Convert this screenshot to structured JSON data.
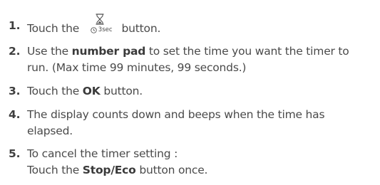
{
  "steps": [
    {
      "number": "1.",
      "before_icon": "Touch the",
      "icon": "hourglass-timer-icon",
      "icon_label": "3sec",
      "after_icon": "button."
    },
    {
      "number": "2.",
      "line1_pre": "Use the",
      "line1_bold": "number pad",
      "line1_post": "to set the time you want the timer to",
      "line2": "run. (Max time 99 minutes, 99 seconds.)"
    },
    {
      "number": "3.",
      "pre": "Touch the",
      "bold": "OK",
      "post": "button."
    },
    {
      "number": "4.",
      "line1": "The display counts down and beeps when the time has",
      "line2": "elapsed."
    },
    {
      "number": "5.",
      "line1": "To cancel the timer setting :",
      "line2_pre": "Touch the",
      "line2_bold": "Stop/Eco",
      "line2_post": "button once."
    }
  ]
}
